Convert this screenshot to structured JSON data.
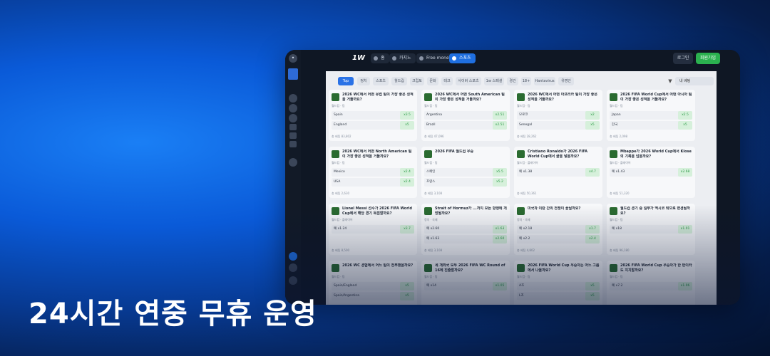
{
  "hero_text": "24시간 연중 무휴 운영",
  "topbar": {
    "brand": "1W",
    "nav": [
      "홈",
      "카지노",
      "Free money",
      "스포츠"
    ],
    "login": "로그인",
    "register": "회원가입"
  },
  "filters": {
    "chips": [
      "Top",
      "정치",
      "스포츠",
      "월드컵",
      "크립토",
      "문화",
      "테크",
      "사이버 스포츠",
      "1w 스페셜",
      "경건",
      "18+",
      "Hantavirus",
      "유명인"
    ],
    "bet_button": "내 베팅"
  },
  "cards": [
    {
      "q": "2026 WC에서 어떤 유럽 팀이 가장 좋은 성적을 거둘까요?",
      "cat": "월드컵 · 팀",
      "rows": [
        {
          "label": "Spain",
          "odd": "x3.5"
        },
        {
          "label": "England",
          "odd": "x5"
        }
      ],
      "foot": "총 베팅 83,802"
    },
    {
      "q": "2026 WC에서 어떤 South American 팀이 가장 좋은 성적을 거둘까요?",
      "cat": "월드컵 · 팀",
      "rows": [
        {
          "label": "Argentina",
          "odd": "x2.51"
        },
        {
          "label": "Brazil",
          "odd": "x2.51"
        }
      ],
      "foot": "총 베팅 47,096"
    },
    {
      "q": "2026 WC에서 어떤 아프리카 팀이 가장 좋은 성적을 거둘까요?",
      "cat": "월드컵 · 팀",
      "rows": [
        {
          "label": "모로코",
          "odd": "x2"
        },
        {
          "label": "Senegal",
          "odd": "x5"
        }
      ],
      "foot": "총 베팅 28,262"
    },
    {
      "q": "2026 FIFA World Cup에서 어떤 아시아 팀이 가장 좋은 성적을 거둘까요?",
      "cat": "월드컵 · 팀",
      "rows": [
        {
          "label": "Japan",
          "odd": "x2.5"
        },
        {
          "label": "한국",
          "odd": "x5"
        }
      ],
      "foot": "총 베팅 2,098"
    },
    {
      "q": "2026 WC에서 어떤 North American 팀이 가장 좋은 성적을 거둘까요?",
      "cat": "월드컵 · 팀",
      "rows": [
        {
          "label": "Mexico",
          "odd": "x2.4"
        },
        {
          "label": "USA",
          "odd": "x2.4"
        }
      ],
      "foot": "총 베팅 2,630"
    },
    {
      "q": "2026 FIFA 월드컵 우승",
      "cat": "월드컵 · 팀",
      "rows": [
        {
          "label": "스페인",
          "odd": "x5.5"
        },
        {
          "label": "프랑스",
          "odd": "x5.2"
        }
      ],
      "foot": "총 베팅 3,108"
    },
    {
      "q": "Cristiano Ronaldo가 2026 FIFA World Cup에서 골을 넣을까요?",
      "cat": "월드컵 · 플레이어",
      "rows": [
        {
          "label": "예 x1.38",
          "odd": "x4.7"
        }
      ],
      "foot": "총 베팅 50,361"
    },
    {
      "q": "Mbappe가 2026 World Cup에서 Klose의 기록을 넘을까요?",
      "cat": "월드컵 · 플레이어",
      "rows": [
        {
          "label": "예 x1.43",
          "odd": "x2.68"
        }
      ],
      "foot": "총 베팅 51,320"
    },
    {
      "q": "Lionel Messi 선수가 2026 FIFA World Cup에서 해당 경기 득점할까요?",
      "cat": "월드컵 · 플레이어",
      "rows": [
        {
          "label": "예 x1.24",
          "odd": "x3.7"
        }
      ],
      "foot": "총 베팅 8,500"
    },
    {
      "q": "Strait of Hormuz가 ...까지 모든 항행에 개방될까요?",
      "cat": "정치 · 국제",
      "rows": [
        {
          "label": "예 x2.60",
          "odd": "x1.63"
        },
        {
          "label": "예 x1.63",
          "odd": "x2.60"
        }
      ],
      "foot": "총 베팅 3,108"
    },
    {
      "q": "미국과 이란 간의 전쟁이 끝날까요?",
      "cat": "정치 · 국제",
      "rows": [
        {
          "label": "예 x2.18",
          "odd": "x1.7"
        },
        {
          "label": "예 x2.2",
          "odd": "x2.4"
        }
      ],
      "foot": "총 베팅 4,802"
    },
    {
      "q": "월드컵 경기 중 일부가 멕시코 밖으로 변경될까요?",
      "cat": "월드컵 · 팀",
      "rows": [
        {
          "label": "예 x18",
          "odd": "x1.01"
        }
      ],
      "foot": "총 베팅 96,180"
    },
    {
      "q": "2026 WC 경험에서 어느 팀이 전부했을까요?",
      "cat": "월드컵 · 팀",
      "rows": [
        {
          "label": "Spain/England",
          "odd": "x5"
        },
        {
          "label": "Spain/Argentina",
          "odd": "x5"
        }
      ],
      "foot": ""
    },
    {
      "q": "세 개최국 모두 2026 FIFA WC Round of 16에 진출할까요?",
      "cat": "월드컵 · 팀",
      "rows": [
        {
          "label": "예 x14",
          "odd": "x1.05"
        }
      ],
      "foot": ""
    },
    {
      "q": "2026 FIFA World Cup 우승자는 어느 그룹에서 나올까요?",
      "cat": "월드컵 · 팀",
      "rows": [
        {
          "label": "A조",
          "odd": "x5"
        },
        {
          "label": "L조",
          "odd": "x5"
        }
      ],
      "foot": ""
    },
    {
      "q": "2026 FIFA World Cup 우승자가 한 번이라도 지지할까요?",
      "cat": "월드컵 · 팀",
      "rows": [
        {
          "label": "예 x7.2",
          "odd": "x1.06"
        }
      ],
      "foot": ""
    }
  ]
}
